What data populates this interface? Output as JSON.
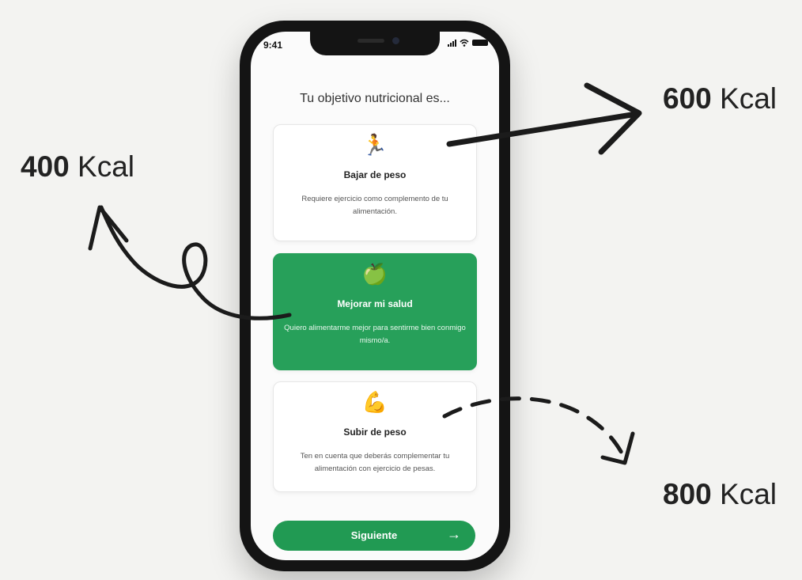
{
  "statusbar": {
    "time": "9:41"
  },
  "screen": {
    "title": "Tu objetivo nutricional es...",
    "cards": [
      {
        "emoji": "🏃",
        "icon": "runner-icon",
        "title": "Bajar de peso",
        "desc": "Requiere ejercicio como complemento de tu alimentación.",
        "selected": false
      },
      {
        "emoji": "🍏",
        "icon": "apple-icon",
        "title": "Mejorar mi salud",
        "desc": "Quiero alimentarme mejor para sentirme bien conmigo mismo/a.",
        "selected": true
      },
      {
        "emoji": "💪",
        "icon": "muscle-icon",
        "title": "Subir de peso",
        "desc": "Ten en cuenta que deberás complementar tu alimentación con ejercicio de pesas.",
        "selected": false
      }
    ],
    "next_label": "Siguiente"
  },
  "annotations": {
    "a600": {
      "value": "600",
      "unit": "Kcal"
    },
    "a400": {
      "value": "400",
      "unit": "Kcal"
    },
    "a800": {
      "value": "800",
      "unit": "Kcal"
    }
  },
  "colors": {
    "accent": "#219a53",
    "card_selected": "#27a05a",
    "background": "#f3f3f1"
  }
}
